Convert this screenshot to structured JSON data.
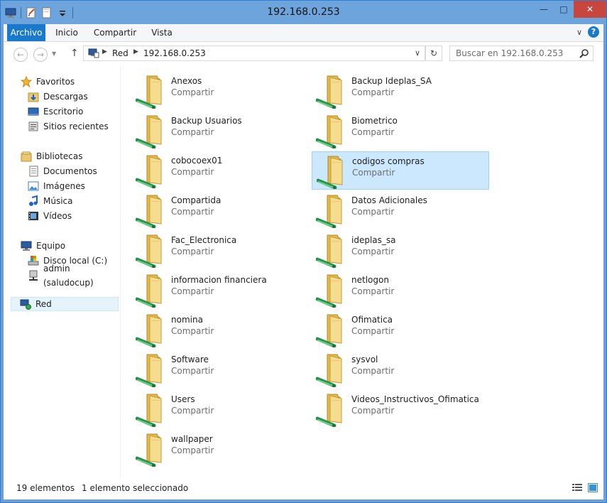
{
  "window": {
    "title": "192.168.0.253",
    "accent": "#1979ca",
    "titlebar_color": "#6ea4dc"
  },
  "caption_buttons": {
    "minimize": "—",
    "maximize": "□",
    "close": "✕"
  },
  "ribbon": {
    "tabs": [
      "Archivo",
      "Inicio",
      "Compartir",
      "Vista"
    ],
    "collapse_glyph": "∨",
    "help_glyph": "?"
  },
  "address": {
    "back_glyph": "←",
    "forward_glyph": "→",
    "up_glyph": "↑",
    "crumbs": [
      "Red",
      "192.168.0.253"
    ],
    "dropdown_glyph": "∨",
    "refresh_glyph": "↻"
  },
  "search": {
    "placeholder": "Buscar en 192.168.0.253"
  },
  "nav": {
    "favorites": {
      "label": "Favoritos",
      "items": [
        "Descargas",
        "Escritorio",
        "Sitios recientes"
      ]
    },
    "libraries": {
      "label": "Bibliotecas",
      "items": [
        "Documentos",
        "Imágenes",
        "Música",
        "Vídeos"
      ]
    },
    "computer": {
      "label": "Equipo",
      "items": [
        "Disco local (C:)",
        "admin (saludocup)"
      ]
    },
    "network": {
      "label": "Red"
    }
  },
  "shares": [
    {
      "name": "Anexos",
      "sub": "Compartir"
    },
    {
      "name": "Backup Ideplas_SA",
      "sub": "Compartir"
    },
    {
      "name": "Backup Usuarios",
      "sub": "Compartir"
    },
    {
      "name": "Biometrico",
      "sub": "Compartir"
    },
    {
      "name": "cobocoex01",
      "sub": "Compartir"
    },
    {
      "name": "codigos compras",
      "sub": "Compartir",
      "selected": true
    },
    {
      "name": "Compartida",
      "sub": "Compartir"
    },
    {
      "name": "Datos Adicionales",
      "sub": "Compartir"
    },
    {
      "name": "Fac_Electronica",
      "sub": "Compartir"
    },
    {
      "name": "ideplas_sa",
      "sub": "Compartir"
    },
    {
      "name": "informacion financiera",
      "sub": "Compartir"
    },
    {
      "name": "netlogon",
      "sub": "Compartir"
    },
    {
      "name": "nomina",
      "sub": "Compartir"
    },
    {
      "name": "Ofimatica",
      "sub": "Compartir"
    },
    {
      "name": "Software",
      "sub": "Compartir"
    },
    {
      "name": "sysvol",
      "sub": "Compartir"
    },
    {
      "name": "Users",
      "sub": "Compartir"
    },
    {
      "name": "Videos_Instructivos_Ofimatica",
      "sub": "Compartir"
    },
    {
      "name": "wallpaper",
      "sub": "Compartir"
    }
  ],
  "status": {
    "count": "19 elementos",
    "selection": "1 elemento seleccionado"
  }
}
